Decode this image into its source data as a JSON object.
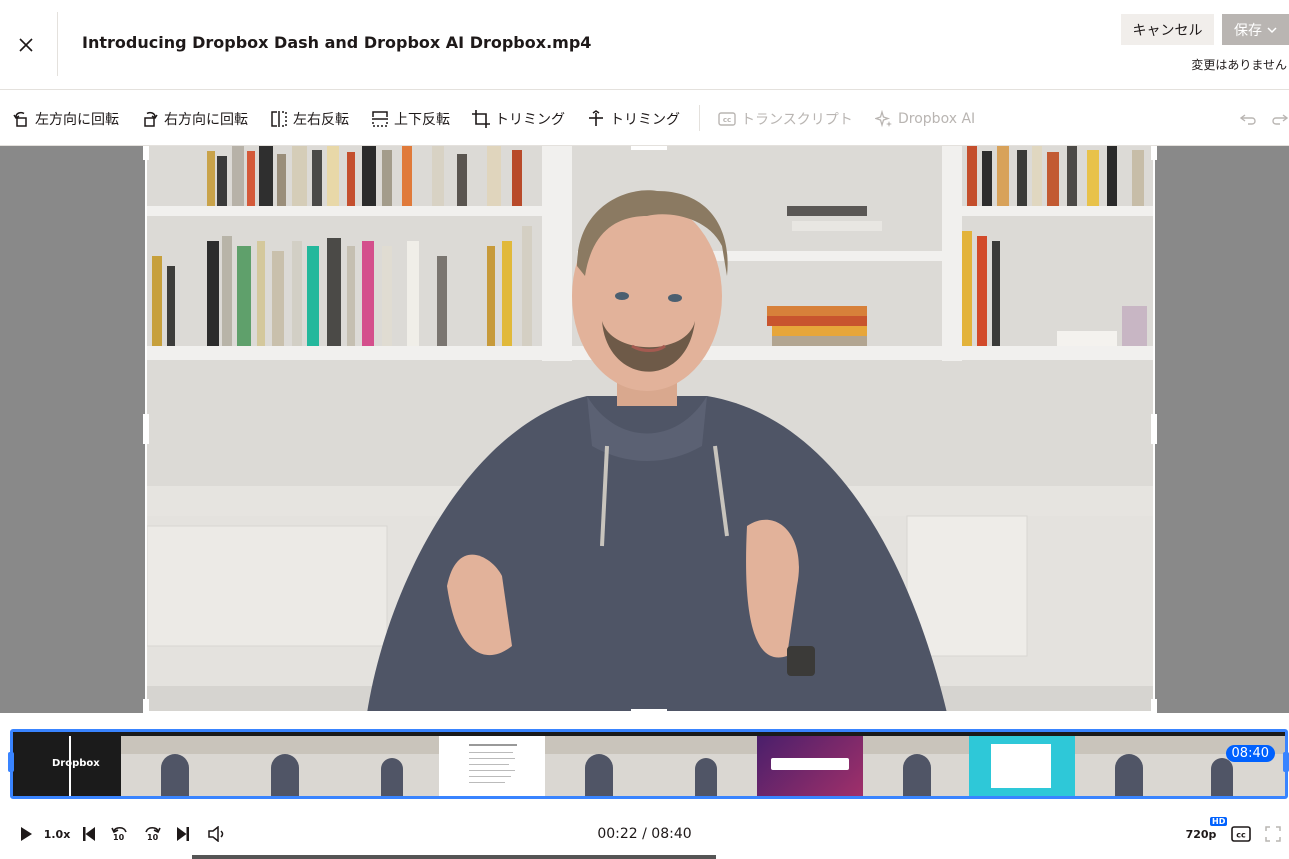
{
  "header": {
    "title": "Introducing Dropbox Dash and Dropbox AI Dropbox.mp4",
    "cancel_label": "キャンセル",
    "save_label": "保存",
    "status": "変更はありません"
  },
  "toolbar": {
    "items": [
      {
        "label": "左方向に回転",
        "icon": "rotate-left-icon",
        "enabled": true
      },
      {
        "label": "右方向に回転",
        "icon": "rotate-right-icon",
        "enabled": true
      },
      {
        "label": "左右反転",
        "icon": "flip-horizontal-icon",
        "enabled": true
      },
      {
        "label": "上下反転",
        "icon": "flip-vertical-icon",
        "enabled": true
      },
      {
        "label": "トリミング",
        "icon": "crop-icon",
        "enabled": true
      },
      {
        "label": "トリミング",
        "icon": "trim-icon",
        "enabled": true
      },
      {
        "label": "トランスクリプト",
        "icon": "transcript-icon",
        "enabled": false
      },
      {
        "label": "Dropbox AI",
        "icon": "sparkle-icon",
        "enabled": false
      }
    ]
  },
  "timeline": {
    "duration_badge": "08:40",
    "first_thumb_text": "Dropbox"
  },
  "player": {
    "speed": "1.0x",
    "timecode": "00:22 / 08:40",
    "quality": "720p",
    "quality_badge": "HD",
    "skip_back_label": "10",
    "skip_forward_label": "10"
  },
  "colors": {
    "accent": "#0061fe",
    "timeline_border": "#3984ff",
    "cancel_bg": "#f1eeeb",
    "save_bg_disabled": "#b9b5b2"
  }
}
